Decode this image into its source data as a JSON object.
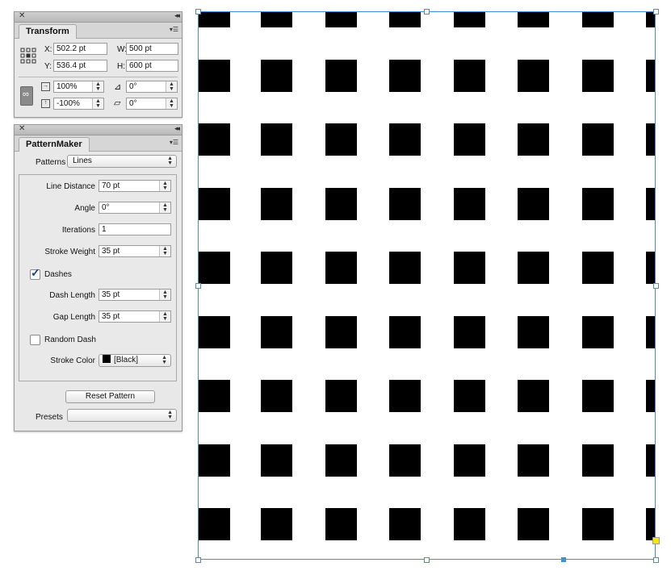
{
  "transform_panel": {
    "tab_title": "Transform",
    "x_label": "X:",
    "x_value": "502.2 pt",
    "y_label": "Y:",
    "y_value": "536.4 pt",
    "w_label": "W:",
    "w_value": "500 pt",
    "h_label": "H:",
    "h_value": "600 pt",
    "scale_x": "100%",
    "scale_y": "-100%",
    "rotate": "0°",
    "shear": "0°"
  },
  "patternmaker_panel": {
    "tab_title": "PatternMaker",
    "patterns_label": "Patterns",
    "patterns_value": "Lines",
    "line_distance_label": "Line Distance",
    "line_distance_value": "70 pt",
    "angle_label": "Angle",
    "angle_value": "0°",
    "iterations_label": "Iterations",
    "iterations_value": "1",
    "stroke_weight_label": "Stroke Weight",
    "stroke_weight_value": "35 pt",
    "dashes_label": "Dashes",
    "dashes_checked": true,
    "dash_length_label": "Dash Length",
    "dash_length_value": "35 pt",
    "gap_length_label": "Gap Length",
    "gap_length_value": "35 pt",
    "random_dash_label": "Random Dash",
    "random_dash_checked": false,
    "stroke_color_label": "Stroke Color",
    "stroke_color_value": "[Black]",
    "stroke_color_swatch": "#000000",
    "reset_button": "Reset Pattern",
    "presets_label": "Presets",
    "presets_value": ""
  },
  "canvas": {
    "pattern": "dashed-lines",
    "fill_color": "#000000",
    "frame_color": "#3d8fe0"
  }
}
